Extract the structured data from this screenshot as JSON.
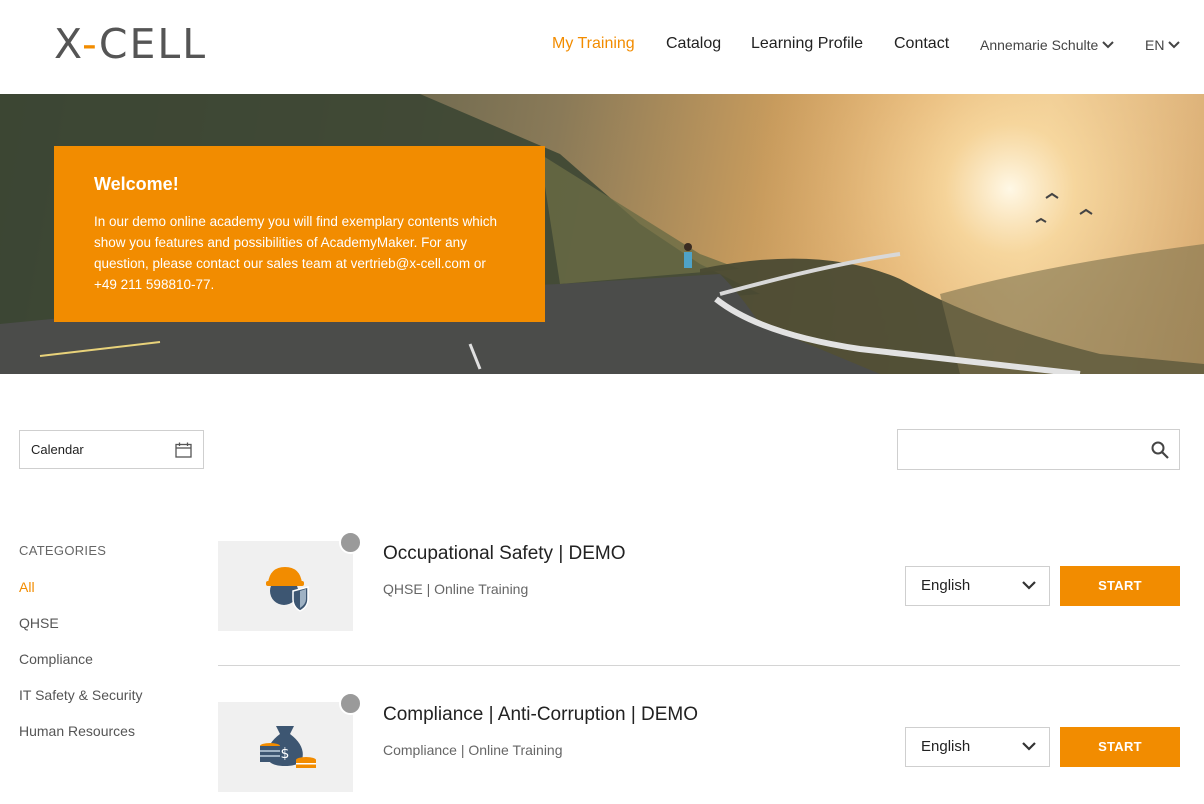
{
  "brand": {
    "logo_left": "X",
    "logo_dash": "-",
    "logo_right": "CELL",
    "accent": "#f28c00"
  },
  "nav": {
    "my_training": "My Training",
    "catalog": "Catalog",
    "learning_profile": "Learning Profile",
    "contact": "Contact",
    "user": "Annemarie Schulte",
    "language": "EN"
  },
  "hero": {
    "welcome_title": "Welcome!",
    "welcome_text": "In our demo online academy you will find exemplary contents which show you features and possibilities of AcademyMaker. For any question, please contact our sales team at vertrieb@x-cell.com or +49 211 598810-77."
  },
  "filters": {
    "calendar_label": "Calendar",
    "search_value": ""
  },
  "categories": {
    "title": "CATEGORIES",
    "items": [
      "All",
      "QHSE",
      "Compliance",
      "IT Safety & Security",
      "Human Resources"
    ],
    "active": "All"
  },
  "courses": [
    {
      "title": "Occupational Safety | DEMO",
      "subtitle": "QHSE | Online Training",
      "language": "English",
      "action": "START",
      "icon": "safety-helmet-shield-icon"
    },
    {
      "title": "Compliance | Anti-Corruption | DEMO",
      "subtitle": "Compliance | Online Training",
      "language": "English",
      "action": "START",
      "icon": "money-bag-coins-icon"
    }
  ]
}
